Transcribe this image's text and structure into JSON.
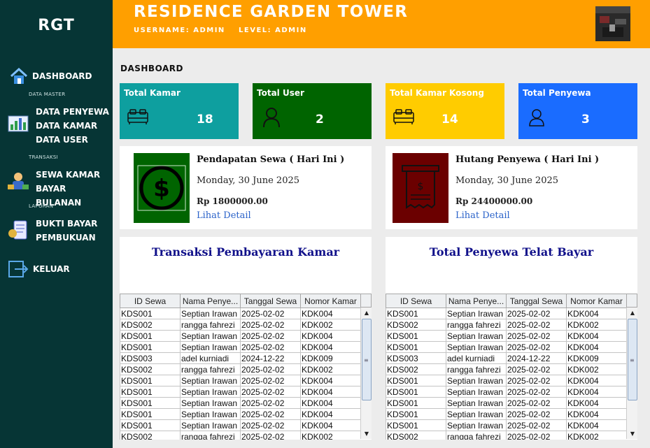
{
  "sidebar": {
    "brand": "RGT",
    "dashboard_label": "DASHBOARD",
    "section_master": "DATA MASTER",
    "master_items": [
      "DATA PENYEWA",
      "DATA KAMAR",
      "DATA USER"
    ],
    "section_transaksi": "TRANSAKSI",
    "transaksi_items": [
      "SEWA KAMAR",
      "BAYAR BULANAN"
    ],
    "section_laporan": "LAPORAN",
    "laporan_items": [
      "BUKTI BAYAR",
      "PEMBUKUAN"
    ],
    "logout_label": "KELUAR"
  },
  "header": {
    "title": "RESIDENCE GARDEN TOWER",
    "username": "USERNAME:  ADMIN",
    "level": "LEVEL:  ADMIN"
  },
  "page_title": "DASHBOARD",
  "stats": [
    {
      "label": "Total Kamar",
      "value": "18",
      "icon": "bed-icon",
      "color": "#0e9f9f"
    },
    {
      "label": "Total User",
      "value": "2",
      "icon": "user-icon",
      "color": "#006400"
    },
    {
      "label": "Total Kamar Kosong",
      "value": "14",
      "icon": "bed-icon",
      "color": "#ffcc00"
    },
    {
      "label": "Total Penyewa",
      "value": "3",
      "icon": "user-icon",
      "color": "#1a6cff"
    }
  ],
  "income": {
    "title": "Pendapatan Sewa ( Hari Ini )",
    "date": "Monday, 30 June 2025",
    "amount": "Rp 1800000.00",
    "link": "Lihat Detail",
    "color": "#006400"
  },
  "debt": {
    "title": "Hutang Penyewa ( Hari Ini )",
    "date": "Monday, 30 June 2025",
    "amount": "Rp 24400000.00",
    "link": "Lihat Detail",
    "color": "#6b0000"
  },
  "columns": [
    "ID Sewa",
    "Nama Penye...",
    "Tanggal Sewa",
    "Nomor Kamar"
  ],
  "payments": {
    "title": "Transaksi Pembayaran Kamar",
    "rows": [
      [
        "KDS001",
        "Septian Irawan",
        "2025-02-02",
        "KDK004"
      ],
      [
        "KDS002",
        "rangga fahrezi",
        "2025-02-02",
        "KDK002"
      ],
      [
        "KDS001",
        "Septian Irawan",
        "2025-02-02",
        "KDK004"
      ],
      [
        "KDS001",
        "Septian Irawan",
        "2025-02-02",
        "KDK004"
      ],
      [
        "KDS003",
        "adel kurniadi",
        "2024-12-22",
        "KDK009"
      ],
      [
        "KDS002",
        "rangga fahrezi",
        "2025-02-02",
        "KDK002"
      ],
      [
        "KDS001",
        "Septian Irawan",
        "2025-02-02",
        "KDK004"
      ],
      [
        "KDS001",
        "Septian Irawan",
        "2025-02-02",
        "KDK004"
      ],
      [
        "KDS001",
        "Septian Irawan",
        "2025-02-02",
        "KDK004"
      ],
      [
        "KDS001",
        "Septian Irawan",
        "2025-02-02",
        "KDK004"
      ],
      [
        "KDS001",
        "Septian Irawan",
        "2025-02-02",
        "KDK004"
      ],
      [
        "KDS002",
        "rangga fahrezi",
        "2025-02-02",
        "KDK002"
      ]
    ]
  },
  "late": {
    "title": "Total Penyewa Telat Bayar",
    "rows": [
      [
        "KDS001",
        "Septian Irawan",
        "2025-02-02",
        "KDK004"
      ],
      [
        "KDS002",
        "rangga fahrezi",
        "2025-02-02",
        "KDK002"
      ],
      [
        "KDS001",
        "Septian Irawan",
        "2025-02-02",
        "KDK004"
      ],
      [
        "KDS001",
        "Septian Irawan",
        "2025-02-02",
        "KDK004"
      ],
      [
        "KDS003",
        "adel kurniadi",
        "2024-12-22",
        "KDK009"
      ],
      [
        "KDS002",
        "rangga fahrezi",
        "2025-02-02",
        "KDK002"
      ],
      [
        "KDS001",
        "Septian Irawan",
        "2025-02-02",
        "KDK004"
      ],
      [
        "KDS001",
        "Septian Irawan",
        "2025-02-02",
        "KDK004"
      ],
      [
        "KDS001",
        "Septian Irawan",
        "2025-02-02",
        "KDK004"
      ],
      [
        "KDS001",
        "Septian Irawan",
        "2025-02-02",
        "KDK004"
      ],
      [
        "KDS001",
        "Septian Irawan",
        "2025-02-02",
        "KDK004"
      ],
      [
        "KDS002",
        "rangga fahrezi",
        "2025-02-02",
        "KDK002"
      ]
    ]
  }
}
